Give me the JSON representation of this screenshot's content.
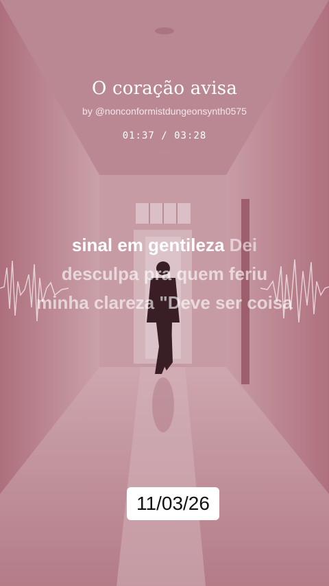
{
  "song": {
    "title": "O coração avisa",
    "byline": "by @nonconformistdungeonsynth0575",
    "time": "01:37 / 03:28"
  },
  "lyrics": {
    "line1_active": "sinal em gentileza",
    "line1_rest": "Dei",
    "line2": "desculpa pra quem feriu",
    "line3": "minha clareza \"Deve ser coisa"
  },
  "date_badge": "11/03/26",
  "colors": {
    "tint": "#c79aa3",
    "text": "#ffffff"
  }
}
